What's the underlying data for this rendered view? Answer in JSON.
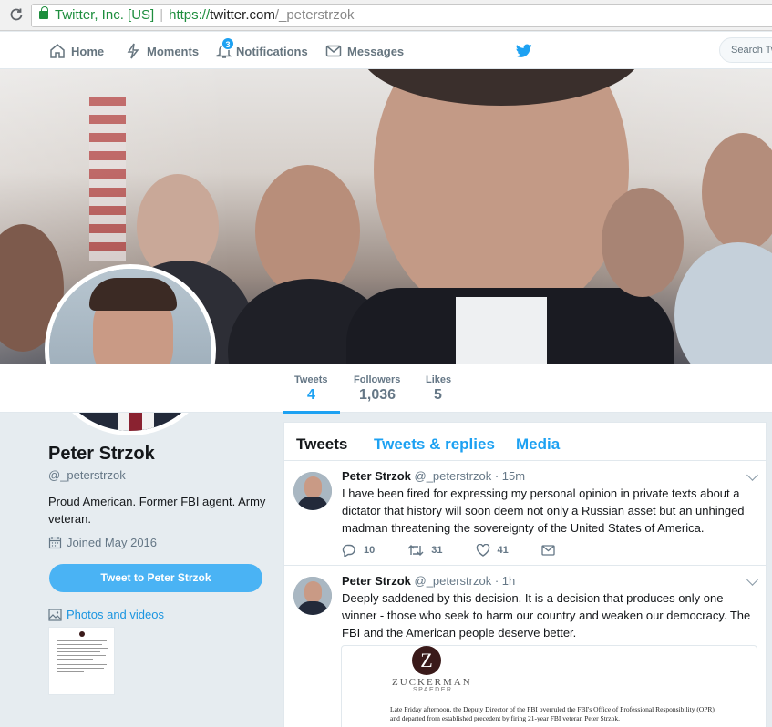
{
  "browser": {
    "secure_label": "Twitter, Inc. [US]",
    "url_scheme": "https://",
    "url_host": "twitter.com",
    "url_path": "/_peterstrzok"
  },
  "nav": {
    "home": "Home",
    "moments": "Moments",
    "notifications": "Notifications",
    "notifications_count": "3",
    "messages": "Messages",
    "search_placeholder": "Search Tw"
  },
  "profile": {
    "name": "Peter Strzok",
    "handle": "@_peterstrzok",
    "bio": "Proud American. Former FBI agent. Army veteran.",
    "joined": "Joined May 2016",
    "tweet_to_button": "Tweet to Peter Strzok",
    "photos_link": "Photos and videos"
  },
  "stats": [
    {
      "label": "Tweets",
      "value": "4"
    },
    {
      "label": "Followers",
      "value": "1,036"
    },
    {
      "label": "Likes",
      "value": "5"
    }
  ],
  "tabs": [
    "Tweets",
    "Tweets & replies",
    "Media"
  ],
  "tweets": [
    {
      "name": "Peter Strzok",
      "handle": "@_peterstrzok",
      "time": "· 15m",
      "text": "I have been fired for expressing my personal opinion in private texts about a dictator that history will soon deem not only a Russian asset but an unhinged madman threatening the sovereignty of the United States of America.",
      "replies": "10",
      "retweets": "31",
      "likes": "41"
    },
    {
      "name": "Peter Strzok",
      "handle": "@_peterstrzok",
      "time": "· 1h",
      "text": "Deeply saddened by this decision. It is a decision that produces only one winner - those who seek to harm our country and weaken our democracy. The FBI and the American people deserve better."
    }
  ],
  "card": {
    "logo_letter": "Z",
    "firm_name": "ZUCKERMAN",
    "firm_sub": "SPAEDER",
    "excerpt": "Late Friday afternoon, the Deputy Director of the FBI overruled the FBI's Office of Professional Responsibility (OPR) and departed from established precedent by firing 21-year FBI veteran Peter Strzok."
  },
  "colors": {
    "accent": "#1da1f2",
    "button": "#4ab3f4",
    "secure_green": "#1e8e3e"
  }
}
